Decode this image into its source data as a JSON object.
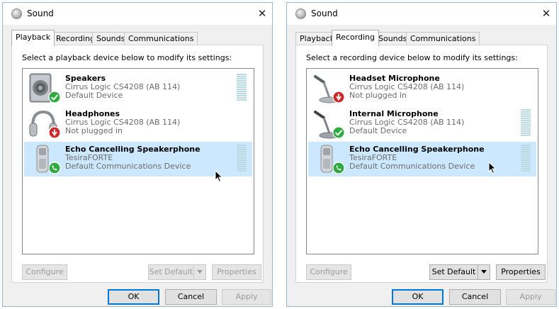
{
  "dialogs": [
    {
      "title": "Sound",
      "close": "✕",
      "tabs": [
        "Playback",
        "Recording",
        "Sounds",
        "Communications"
      ],
      "active_tab": "Playback",
      "instruction": "Select a playback device below to modify its settings:",
      "devices": [
        {
          "name": "Speakers",
          "driver": "Cirrus Logic CS4208 (AB 114)",
          "status": "Default Device",
          "icon": "speaker-icon",
          "badge": "green-check-badge",
          "selected": false
        },
        {
          "name": "Headphones",
          "driver": "Cirrus Logic CS4208 (AB 114)",
          "status": "Not plugged in",
          "icon": "headphones-icon",
          "badge": "red-unplugged-badge",
          "selected": false
        },
        {
          "name": "Echo Cancelling Speakerphone",
          "driver": "TesiraFORTE",
          "status": "Default Communications Device",
          "icon": "phone-icon",
          "badge": "green-phone-badge",
          "selected": true
        }
      ],
      "buttons": {
        "configure": "Configure",
        "set_default": "Set Default",
        "properties": "Properties",
        "ok": "OK",
        "cancel": "Cancel",
        "apply": "Apply"
      },
      "button_states": {
        "configure": "disabled",
        "set_default": "disabled",
        "properties": "disabled",
        "apply": "disabled"
      }
    },
    {
      "title": "Sound",
      "close": "✕",
      "tabs": [
        "Playback",
        "Recording",
        "Sounds",
        "Communications"
      ],
      "active_tab": "Recording",
      "instruction": "Select a recording device below to modify its settings:",
      "devices": [
        {
          "name": "Headset Microphone",
          "driver": "Cirrus Logic CS4208 (AB 114)",
          "status": "Not plugged in",
          "icon": "microphone-icon",
          "badge": "red-unplugged-badge",
          "selected": false
        },
        {
          "name": "Internal Microphone",
          "driver": "Cirrus Logic CS4208 (AB 114)",
          "status": "Default Device",
          "icon": "microphone-icon",
          "badge": "green-check-badge",
          "selected": false
        },
        {
          "name": "Echo Cancelling Speakerphone",
          "driver": "TesiraFORTE",
          "status": "Default Communications Device",
          "icon": "phone-icon",
          "badge": "green-phone-badge",
          "selected": true
        }
      ],
      "buttons": {
        "configure": "Configure",
        "set_default": "Set Default",
        "properties": "Properties",
        "ok": "OK",
        "cancel": "Cancel",
        "apply": "Apply"
      },
      "button_states": {
        "configure": "disabled",
        "set_default": "enabled",
        "properties": "enabled",
        "apply": "disabled"
      }
    }
  ],
  "colors": {
    "selection": "#cce8ff",
    "accent": "#0078d7",
    "meter": "#b9d9e3",
    "disabled_text": "#9b9b9b"
  }
}
